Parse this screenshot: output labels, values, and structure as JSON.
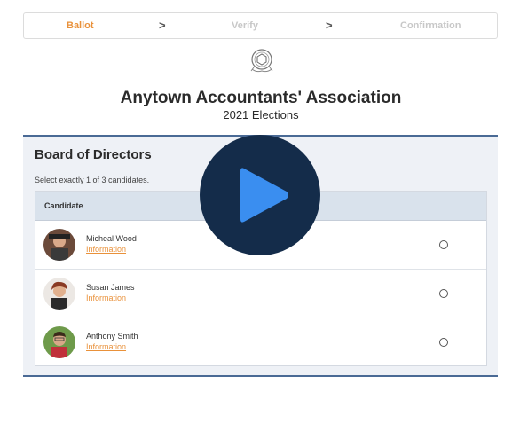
{
  "steps": [
    {
      "label": "Ballot",
      "active": true
    },
    {
      "label": "Verify",
      "active": false
    },
    {
      "label": "Confirmation",
      "active": false
    }
  ],
  "step_separator": ">",
  "logo_icon": "association-seal-icon",
  "header": {
    "title": "Anytown Accountants' Association",
    "subtitle": "2021 Elections"
  },
  "contest": {
    "title": "Board of Directors",
    "instructions": "Select exactly 1 of 3 candidates.",
    "column_header": "Candidate",
    "candidates": [
      {
        "name": "Micheal Wood",
        "info_label": "Information"
      },
      {
        "name": "Susan James",
        "info_label": "Information"
      },
      {
        "name": "Anthony Smith",
        "info_label": "Information"
      }
    ]
  },
  "overlay": {
    "icon": "play-icon"
  },
  "colors": {
    "accent": "#e9913a",
    "brand_dark": "#142c4a",
    "play": "#3a8ef0",
    "panel_border": "#4a6a95"
  }
}
